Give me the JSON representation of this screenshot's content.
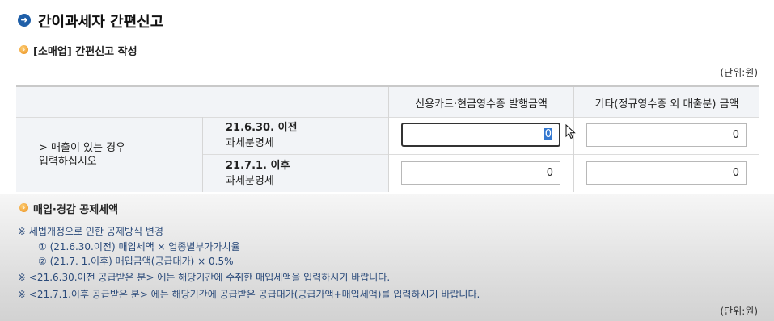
{
  "page": {
    "title": "간이과세자 간편신고",
    "section_label": "[소매업] 간편신고 작성",
    "unit_top": "(단위:원)",
    "unit_bottom": "(단위:원)"
  },
  "table": {
    "col_heads": [
      "신용카드·현금영수증 발행금액",
      "기타(정규영수증 외 매출분) 금액"
    ],
    "left_label_line1": "> 매출이 있는 경우",
    "left_label_line2": "입력하십시오",
    "rows": [
      {
        "label_line1": "21.6.30. 이전",
        "label_line2": "과세분명세",
        "card_value": "0",
        "other_value": "0"
      },
      {
        "label_line1": "21.7.1. 이후",
        "label_line2": "과세분명세",
        "card_value": "0",
        "other_value": "0"
      }
    ]
  },
  "deduction": {
    "title": "매입·경감 공제세액",
    "notes": [
      "※ 세법개정으로 인한 공제방식 변경",
      "① (21.6.30.이전) 매입세액 × 업종별부가가치율",
      "② (21.7. 1.이후) 매입금액(공급대가) × 0.5%",
      "※ <21.6.30.이전 공급받은 분> 에는 해당기간에 수취한 매입세액을 입력하시기 바랍니다.",
      "※ <21.7.1.이후 공급받은 분> 에는 해당기간에 공급받은 공급대가(공급가액+매입세액)를 입력하시기 바랍니다."
    ]
  },
  "icons": {
    "title_icon": "arrow-right-circle-icon",
    "section_icon": "orange-bullet-icon",
    "cursor": "mouse-pointer-icon"
  },
  "colors": {
    "title_icon": "#1f5fa8",
    "bullet": "#e88a16",
    "table_header_bg": "#f2f4f7",
    "note_text": "#2a4a7a",
    "selection": "#3478d0"
  }
}
